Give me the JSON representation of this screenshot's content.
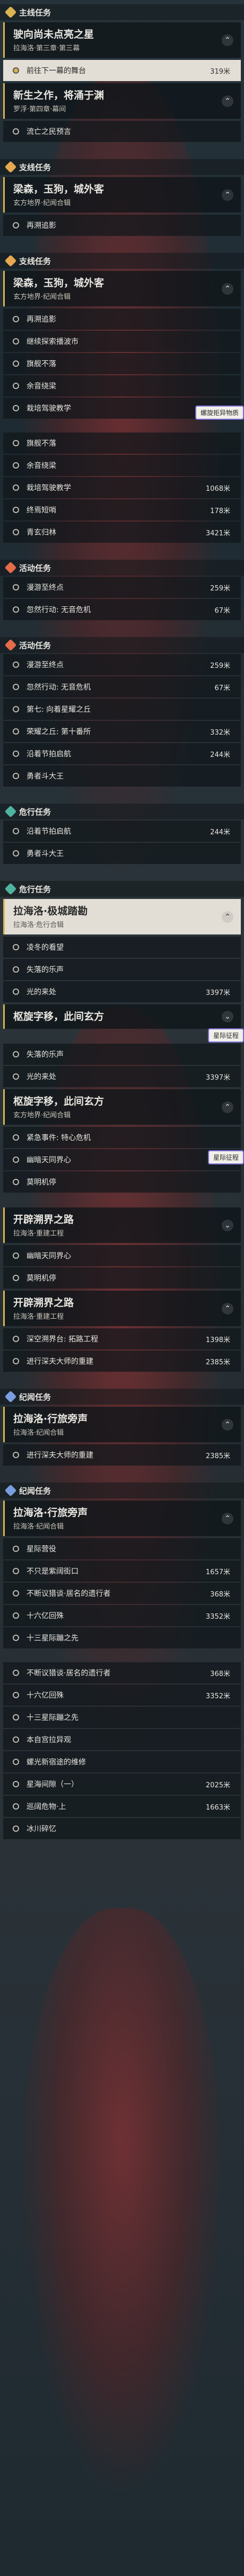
{
  "colors": {
    "trailblaze": "#d9b451",
    "daily": "#e7a84f",
    "event": "#e56b4a",
    "companion": "#4fb3a0"
  },
  "sections": [
    {
      "category": "主线任务",
      "cat_color": "#d9b451",
      "heads": [
        {
          "title": "驶向尚未点亮之星",
          "sub": "拉海洛·第三章·第三幕",
          "selected": false,
          "chev": "⌃",
          "rows": [
            {
              "label": "前往下一幕的舞台",
              "dist": "319米",
              "selected": true
            }
          ]
        },
        {
          "title": "新生之作，将涌于渊",
          "sub": "罗浮·第四章·幕间",
          "selected": false,
          "chev": "⌃",
          "rows": [
            {
              "label": "流亡之民预言",
              "dist": ""
            }
          ]
        }
      ]
    },
    {
      "category": "支线任务",
      "cat_color": "#e7a84f",
      "heads": [
        {
          "title": "梁森，玉狗，城外客",
          "sub": "玄方地界·纪闻合辑",
          "selected": false,
          "chev": "⌃",
          "rows": [
            {
              "label": "再溯追影",
              "dist": ""
            }
          ]
        }
      ]
    },
    {
      "category": "支线任务",
      "cat_color": "#e7a84f",
      "heads": [
        {
          "title": "梁森，玉狗，城外客",
          "sub": "玄方地界·纪闻合辑",
          "selected": false,
          "chev": "⌃",
          "rows": [
            {
              "label": "再溯追影",
              "dist": ""
            },
            {
              "label": "继续探索播波市",
              "dist": ""
            },
            {
              "label": "旗舰不落",
              "dist": ""
            },
            {
              "label": "余音绕梁",
              "dist": ""
            },
            {
              "label": "栽培驾驶教学",
              "dist": "1068米"
            }
          ]
        }
      ]
    },
    {
      "category": "",
      "cat_color": "",
      "heads": [
        {
          "title": "",
          "sub": "",
          "selected": false,
          "chev": "",
          "rows": [
            {
              "label": "旗舰不落",
              "dist": ""
            },
            {
              "label": "余音绕梁",
              "dist": ""
            },
            {
              "label": "栽培驾驶教学",
              "dist": "1068米"
            },
            {
              "label": "终焉短哨",
              "dist": "178米"
            },
            {
              "label": "青玄归林",
              "dist": "3421米"
            }
          ]
        }
      ]
    },
    {
      "category": "活动任务",
      "cat_color": "#e56b4a",
      "heads": [
        {
          "title": "",
          "sub": "",
          "selected": false,
          "chev": "",
          "rows": [
            {
              "label": "漫游至终点",
              "dist": "259米"
            },
            {
              "label": "忽然行动: 无音危机",
              "dist": "67米"
            }
          ]
        }
      ]
    },
    {
      "category": "活动任务",
      "cat_color": "#e56b4a",
      "heads": [
        {
          "title": "",
          "sub": "",
          "selected": false,
          "chev": "",
          "rows": [
            {
              "label": "漫游至终点",
              "dist": "259米"
            },
            {
              "label": "忽然行动: 无音危机",
              "dist": "67米"
            },
            {
              "label": "第七: 向着星耀之丘",
              "dist": ""
            },
            {
              "label": "荣耀之丘: 第十番所",
              "dist": "332米"
            },
            {
              "label": "沿着节拍启航",
              "dist": "244米"
            },
            {
              "label": "勇者斗大王",
              "dist": ""
            }
          ]
        }
      ]
    },
    {
      "category": "危行任务",
      "cat_color": "#4fb3a0",
      "heads": [
        {
          "title": "",
          "sub": "",
          "selected": false,
          "chev": "",
          "rows": [
            {
              "label": "沿着节拍启航",
              "dist": "244米"
            },
            {
              "label": "勇者斗大王",
              "dist": ""
            }
          ]
        }
      ]
    },
    {
      "category": "危行任务",
      "cat_color": "#4fb3a0",
      "heads": [
        {
          "title": "拉海洛·极城踏勘",
          "sub": "拉海洛·危行合辑",
          "selected": true,
          "chev": "⌃",
          "rows": [
            {
              "label": "凌冬的看望",
              "dist": ""
            },
            {
              "label": "失落的乐声",
              "dist": ""
            },
            {
              "label": "光的来处",
              "dist": "3397米"
            }
          ]
        },
        {
          "title": "枢旋字移，此间玄方",
          "sub": "",
          "selected": false,
          "chev": "⌄",
          "rows": []
        }
      ]
    },
    {
      "category": "",
      "cat_color": "",
      "heads": [
        {
          "title": "",
          "sub": "",
          "selected": false,
          "chev": "",
          "rows": [
            {
              "label": "失落的乐声",
              "dist": ""
            },
            {
              "label": "光的来处",
              "dist": "3397米"
            }
          ]
        },
        {
          "title": "枢旋字移，此间玄方",
          "sub": "玄方地界·纪闻合辑",
          "selected": false,
          "chev": "⌃",
          "rows": [
            {
              "label": "紧急事件: 特心危机",
              "dist": ""
            },
            {
              "label": "幽暗天同界心",
              "dist": ""
            },
            {
              "label": "莫明机停",
              "dist": ""
            }
          ]
        }
      ]
    },
    {
      "category": "",
      "cat_color": "",
      "heads": [
        {
          "title": "开辟溯界之路",
          "sub": "拉海洛·重建工程",
          "selected": false,
          "chev": "⌄",
          "rows": [
            {
              "label": "幽暗天同界心",
              "dist": ""
            },
            {
              "label": "莫明机停",
              "dist": ""
            }
          ]
        },
        {
          "title": "开辟溯界之路",
          "sub": "拉海洛·重建工程",
          "selected": false,
          "chev": "⌃",
          "rows": [
            {
              "label": "深空溯界台: 拓路工程",
              "dist": "1398米"
            },
            {
              "label": "进行深夫大师的重建",
              "dist": "2385米"
            }
          ]
        }
      ]
    },
    {
      "category": "纪闻任务",
      "cat_color": "#7a9ee0",
      "heads": [
        {
          "title": "拉海洛·行旅旁声",
          "sub": "拉海洛·纪闻合辑",
          "selected": false,
          "chev": "⌃",
          "rows": [
            {
              "label": "进行深夫大师的重建",
              "dist": "2385米"
            }
          ]
        }
      ]
    },
    {
      "category": "纪闻任务",
      "cat_color": "#7a9ee0",
      "heads": [
        {
          "title": "拉海洛·行旅旁声",
          "sub": "拉海洛·纪闻合辑",
          "selected": false,
          "chev": "⌃",
          "rows": [
            {
              "label": "星际营役",
              "dist": ""
            },
            {
              "label": "不只是紫阔街口",
              "dist": "1657米"
            },
            {
              "label": "不断议猎谈·居名的遗行者",
              "dist": "368米"
            },
            {
              "label": "十六亿回殊",
              "dist": "3352米"
            },
            {
              "label": "十三星际蹦之先",
              "dist": ""
            }
          ]
        }
      ]
    },
    {
      "category": "",
      "cat_color": "",
      "heads": [
        {
          "title": "",
          "sub": "",
          "selected": false,
          "chev": "",
          "rows": [
            {
              "label": "不断议猎谈·居名的遗行者",
              "dist": "368米"
            },
            {
              "label": "十六亿回殊",
              "dist": "3352米"
            },
            {
              "label": "十三星际蹦之先",
              "dist": ""
            },
            {
              "label": "本自宫拉异观",
              "dist": ""
            },
            {
              "label": "螺光新宿途的维修",
              "dist": ""
            },
            {
              "label": "星海间隙（一）",
              "dist": "2025米"
            },
            {
              "label": "巡阔危物·上",
              "dist": "1663米"
            },
            {
              "label": "冰川碎忆",
              "dist": ""
            }
          ]
        }
      ]
    }
  ],
  "badges": [
    {
      "text": "螺旋拒异物质"
    },
    {
      "text": "星际征程"
    },
    {
      "text": "星际征程"
    }
  ]
}
